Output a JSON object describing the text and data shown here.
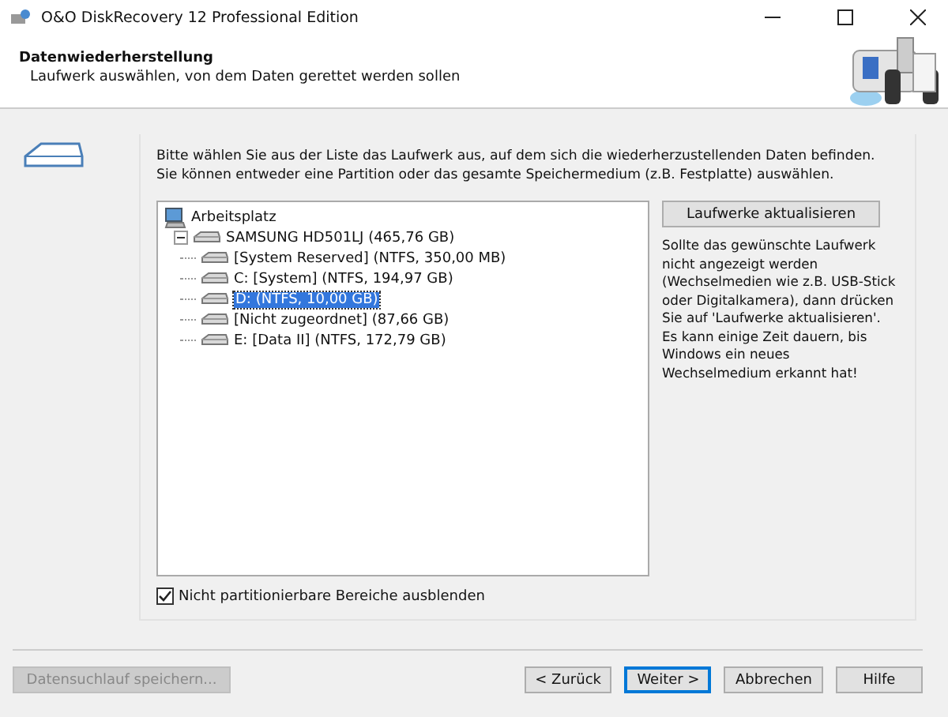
{
  "window": {
    "title": "O&O DiskRecovery 12 Professional Edition"
  },
  "header": {
    "title": "Datenwiederherstellung",
    "subtitle": "Laufwerk auswählen, von dem Daten gerettet werden sollen"
  },
  "instructions": "Bitte wählen Sie aus der Liste das Laufwerk aus, auf dem sich die wiederherzustellenden Daten befinden. Sie können entweder eine Partition oder das gesamte Speichermedium (z.B. Festplatte) auswählen.",
  "tree": [
    {
      "label": "Arbeitsplatz",
      "kind": "computer",
      "selected": false,
      "children": [
        {
          "label": "SAMSUNG HD501LJ (465,76 GB)",
          "kind": "disk",
          "selected": false,
          "expanded": true,
          "children": [
            {
              "label": "[System Reserved] (NTFS, 350,00 MB)",
              "kind": "disk",
              "selected": false
            },
            {
              "label": "C: [System] (NTFS, 194,97 GB)",
              "kind": "disk",
              "selected": false
            },
            {
              "label": "D: (NTFS, 10,00 GB)",
              "kind": "disk",
              "selected": true
            },
            {
              "label": "[Nicht zugeordnet] (87,66 GB)",
              "kind": "disk",
              "selected": false
            },
            {
              "label": "E: [Data II] (NTFS, 172,79 GB)",
              "kind": "disk",
              "selected": false
            }
          ]
        }
      ]
    }
  ],
  "refresh_button": "Laufwerke aktualisieren",
  "hint": "Sollte das gewünschte Laufwerk nicht angezeigt werden (Wechselmedien wie z.B. USB-Stick oder Digitalkamera), dann drücken Sie auf 'Laufwerke aktualisieren'. Es kann einige Zeit dauern, bis Windows ein neues Wechselmedium erkannt hat!",
  "hide_checkbox": {
    "label": "Nicht partitionierbare Bereiche ausblenden",
    "checked": true
  },
  "buttons": [
    {
      "label": "Datensuchlauf speichern...",
      "disabled": true,
      "default": false
    },
    {
      "label": "< Zurück",
      "disabled": false,
      "default": false
    },
    {
      "label": "Weiter >",
      "disabled": false,
      "default": true
    },
    {
      "label": "Abbrechen",
      "disabled": false,
      "default": false
    },
    {
      "label": "Hilfe",
      "disabled": false,
      "default": false
    }
  ]
}
